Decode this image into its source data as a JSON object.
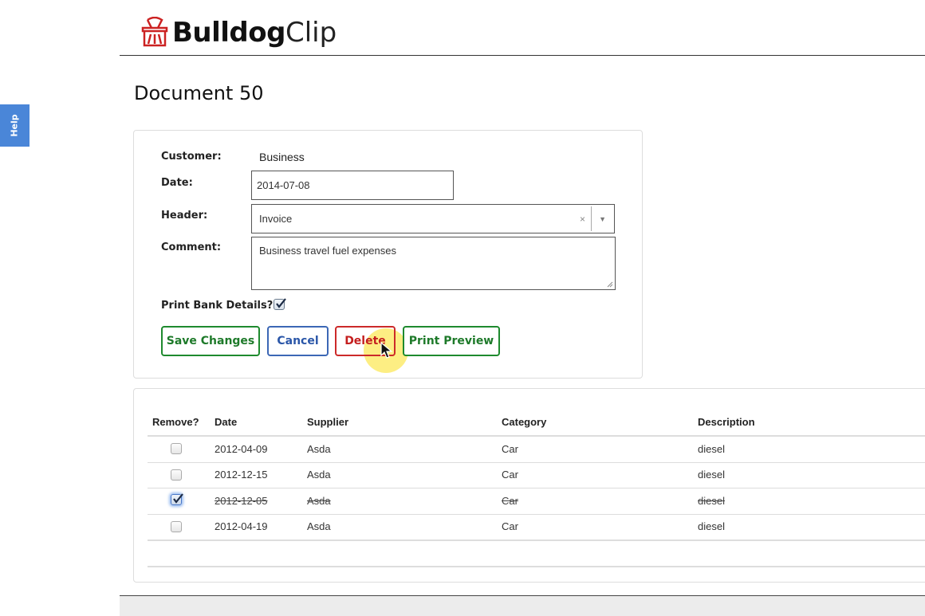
{
  "help_tab": {
    "label": "Help"
  },
  "brand": {
    "name_bold": "Bulldog",
    "name_light": "Clip",
    "accent_color": "#cc2222"
  },
  "page_title": "Document 50",
  "form": {
    "customer": {
      "label": "Customer:",
      "value": "Business"
    },
    "date": {
      "label": "Date:",
      "value": "2014-07-08"
    },
    "header": {
      "label": "Header:",
      "value": "Invoice",
      "clear_glyph": "×",
      "arrow_glyph": "▼"
    },
    "comment": {
      "label": "Comment:",
      "value": "Business travel fuel expenses"
    },
    "print_bank_details": {
      "label": "Print Bank Details?",
      "checked": true
    },
    "buttons": {
      "save": "Save Changes",
      "cancel": "Cancel",
      "delete": "Delete",
      "print_preview": "Print Preview"
    }
  },
  "table": {
    "headers": [
      "Remove?",
      "Date",
      "Supplier",
      "Category",
      "Description"
    ],
    "rows": [
      {
        "remove": false,
        "date": "2012-04-09",
        "supplier": "Asda",
        "category": "Car",
        "description": "diesel"
      },
      {
        "remove": false,
        "date": "2012-12-15",
        "supplier": "Asda",
        "category": "Car",
        "description": "diesel"
      },
      {
        "remove": true,
        "date": "2012-12-05",
        "supplier": "Asda",
        "category": "Car",
        "description": "diesel"
      },
      {
        "remove": false,
        "date": "2012-04-19",
        "supplier": "Asda",
        "category": "Car",
        "description": "diesel"
      }
    ]
  },
  "colors": {
    "save_green": "#1e8a2e",
    "cancel_blue": "#3c67b5",
    "delete_red": "#cc2a2a",
    "help_blue": "#4a86d8",
    "click_highlight": "#fce85a"
  }
}
